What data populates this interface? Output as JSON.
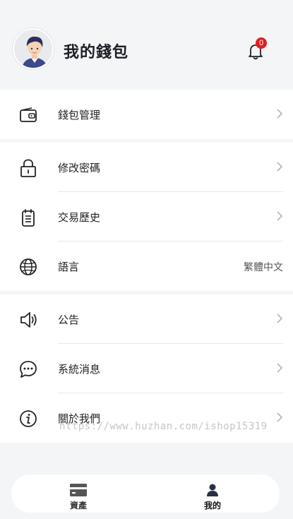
{
  "header": {
    "title": "我的錢包",
    "notification_count": "0"
  },
  "menu": {
    "wallet": {
      "label": "錢包管理"
    },
    "password": {
      "label": "修改密碼"
    },
    "history": {
      "label": "交易歷史"
    },
    "language": {
      "label": "語言",
      "value": "繁體中文"
    },
    "announcement": {
      "label": "公告"
    },
    "messages": {
      "label": "系統消息"
    },
    "about": {
      "label": "關於我們"
    }
  },
  "watermark": "https://www.huzhan.com/ishop15319",
  "tabbar": {
    "assets": {
      "label": "資產",
      "color": "#333333"
    },
    "mine": {
      "label": "我的",
      "color": "#111111"
    }
  },
  "colors": {
    "background": "#f4f5f7",
    "badge": "#e02020",
    "divider": "#e8e8ea"
  }
}
